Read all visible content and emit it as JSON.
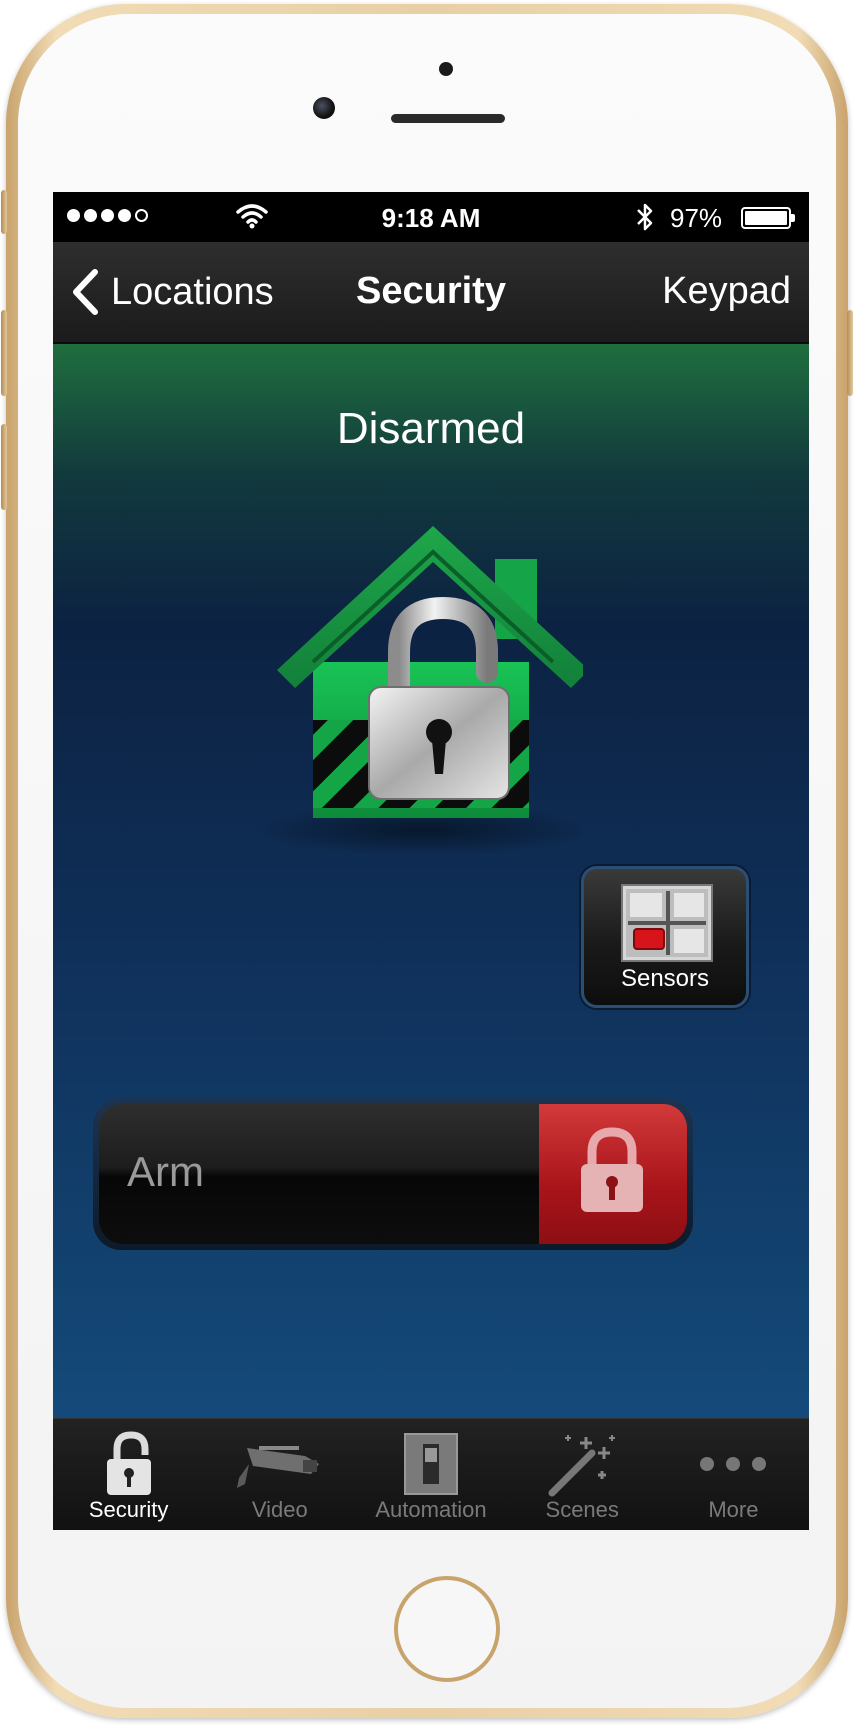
{
  "status_bar": {
    "time": "9:18 AM",
    "battery": "97%",
    "battery_level": 0.97,
    "signal_bars_filled": 4,
    "signal_bars_total": 5,
    "icons": [
      "signal-icon",
      "wifi-icon",
      "bluetooth-icon",
      "battery-icon"
    ]
  },
  "nav": {
    "back_label": "Locations",
    "title": "Security",
    "right_label": "Keypad",
    "back_icon": "chevron-left-icon"
  },
  "main": {
    "status": "Disarmed",
    "house_icon": "unlocked-house-icon",
    "sensors_label": "Sensors",
    "sensors_icon": "sensor-grid-icon",
    "arm_label": "Arm",
    "arm_knob_icon": "lock-icon"
  },
  "tabs": [
    {
      "label": "Security",
      "icon": "padlock-icon",
      "active": true
    },
    {
      "label": "Video",
      "icon": "camera-icon",
      "active": false
    },
    {
      "label": "Automation",
      "icon": "switch-icon",
      "active": false
    },
    {
      "label": "Scenes",
      "icon": "magic-wand-icon",
      "active": false
    },
    {
      "label": "More",
      "icon": "more-dots-icon",
      "active": false
    }
  ],
  "colors": {
    "accent_green": "#1db34c",
    "arm_red": "#b3161c",
    "background_blue": "#0f2f58",
    "bezel_gold": "#e8cfa4"
  }
}
